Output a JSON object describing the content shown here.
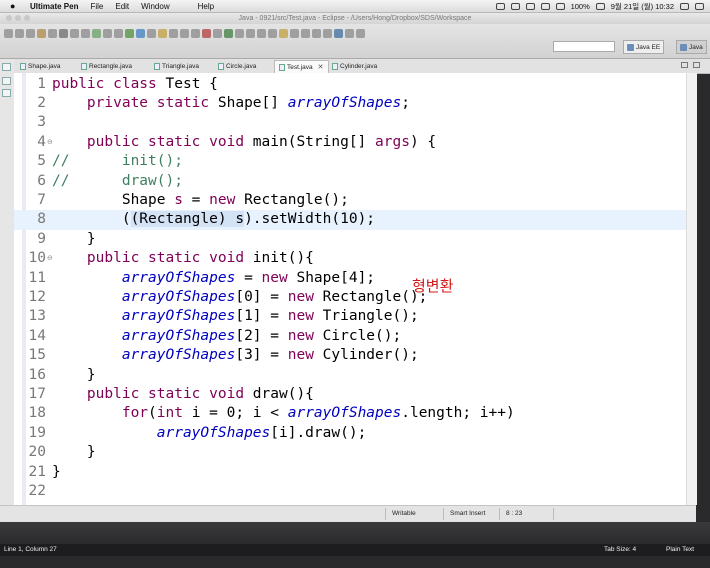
{
  "menubar": {
    "app_name": "Ultimate Pen",
    "items": [
      "File",
      "Edit",
      "Window",
      "Help"
    ],
    "status": {
      "battery": "100%",
      "date_time": "9월 21일 (월)  10:32"
    }
  },
  "window": {
    "title": "Java - 0921/src/Test.java - Eclipse - /Users/Hong/Dropbox/SDS/Workspace"
  },
  "perspectives": [
    "Java EE",
    "Java"
  ],
  "tabs": [
    {
      "label": "Shape.java"
    },
    {
      "label": "Rectangle.java"
    },
    {
      "label": "Triangle.java"
    },
    {
      "label": "Circle.java"
    },
    {
      "label": "Test.java",
      "active": true
    },
    {
      "label": "Cylinder.java"
    }
  ],
  "code_lines": [
    {
      "n": "1",
      "fold": ""
    },
    {
      "n": "2",
      "fold": ""
    },
    {
      "n": "3",
      "fold": ""
    },
    {
      "n": "4",
      "fold": "⊖"
    },
    {
      "n": "5",
      "fold": ""
    },
    {
      "n": "6",
      "fold": ""
    },
    {
      "n": "7",
      "fold": ""
    },
    {
      "n": "8",
      "fold": ""
    },
    {
      "n": "9",
      "fold": ""
    },
    {
      "n": "10",
      "fold": "⊖"
    },
    {
      "n": "11",
      "fold": ""
    },
    {
      "n": "12",
      "fold": ""
    },
    {
      "n": "13",
      "fold": ""
    },
    {
      "n": "14",
      "fold": ""
    },
    {
      "n": "15",
      "fold": ""
    },
    {
      "n": "16",
      "fold": ""
    },
    {
      "n": "17",
      "fold": ""
    },
    {
      "n": "18",
      "fold": ""
    },
    {
      "n": "19",
      "fold": ""
    },
    {
      "n": "20",
      "fold": ""
    },
    {
      "n": "21",
      "fold": ""
    },
    {
      "n": "22",
      "fold": ""
    }
  ],
  "code_tokens": [
    [
      {
        "t": "public class ",
        "c": "kw"
      },
      {
        "t": "Test {",
        "c": ""
      }
    ],
    [
      {
        "t": "    ",
        "c": ""
      },
      {
        "t": "private static ",
        "c": "kw"
      },
      {
        "t": "Shape[] ",
        "c": ""
      },
      {
        "t": "arrayOfShapes",
        "c": "field"
      },
      {
        "t": ";",
        "c": ""
      }
    ],
    [],
    [
      {
        "t": "    ",
        "c": ""
      },
      {
        "t": "public static void ",
        "c": "kw"
      },
      {
        "t": "main(String[] ",
        "c": ""
      },
      {
        "t": "args",
        "c": "kw"
      },
      {
        "t": ") {",
        "c": ""
      }
    ],
    [
      {
        "t": "//      init();",
        "c": "cm"
      }
    ],
    [
      {
        "t": "//      draw();",
        "c": "cm"
      }
    ],
    [
      {
        "t": "        Shape ",
        "c": ""
      },
      {
        "t": "s",
        "c": "kw"
      },
      {
        "t": " = ",
        "c": ""
      },
      {
        "t": "new ",
        "c": "kw"
      },
      {
        "t": "Rectangle();",
        "c": ""
      }
    ],
    [
      {
        "t": "        (",
        "c": ""
      },
      {
        "t": "(Rectangle) s",
        "c": "sel"
      },
      {
        "t": ").setWidth(10);",
        "c": ""
      }
    ],
    [
      {
        "t": "    }",
        "c": ""
      }
    ],
    [
      {
        "t": "    ",
        "c": ""
      },
      {
        "t": "public static void ",
        "c": "kw"
      },
      {
        "t": "init(){",
        "c": ""
      }
    ],
    [
      {
        "t": "        ",
        "c": ""
      },
      {
        "t": "arrayOfShapes",
        "c": "field"
      },
      {
        "t": " = ",
        "c": ""
      },
      {
        "t": "new ",
        "c": "kw"
      },
      {
        "t": "Shape[4];",
        "c": ""
      }
    ],
    [
      {
        "t": "        ",
        "c": ""
      },
      {
        "t": "arrayOfShapes",
        "c": "field"
      },
      {
        "t": "[0] = ",
        "c": ""
      },
      {
        "t": "new ",
        "c": "kw"
      },
      {
        "t": "Rectangle();",
        "c": ""
      }
    ],
    [
      {
        "t": "        ",
        "c": ""
      },
      {
        "t": "arrayOfShapes",
        "c": "field"
      },
      {
        "t": "[1] = ",
        "c": ""
      },
      {
        "t": "new ",
        "c": "kw"
      },
      {
        "t": "Triangle();",
        "c": ""
      }
    ],
    [
      {
        "t": "        ",
        "c": ""
      },
      {
        "t": "arrayOfShapes",
        "c": "field"
      },
      {
        "t": "[2] = ",
        "c": ""
      },
      {
        "t": "new ",
        "c": "kw"
      },
      {
        "t": "Circle();",
        "c": ""
      }
    ],
    [
      {
        "t": "        ",
        "c": ""
      },
      {
        "t": "arrayOfShapes",
        "c": "field"
      },
      {
        "t": "[3] = ",
        "c": ""
      },
      {
        "t": "new ",
        "c": "kw"
      },
      {
        "t": "Cylinder();",
        "c": ""
      }
    ],
    [
      {
        "t": "    }",
        "c": ""
      }
    ],
    [
      {
        "t": "    ",
        "c": ""
      },
      {
        "t": "public static void ",
        "c": "kw"
      },
      {
        "t": "draw(){",
        "c": ""
      }
    ],
    [
      {
        "t": "        ",
        "c": ""
      },
      {
        "t": "for",
        "c": "kw"
      },
      {
        "t": "(",
        "c": ""
      },
      {
        "t": "int ",
        "c": "kw"
      },
      {
        "t": "i = 0; i < ",
        "c": ""
      },
      {
        "t": "arrayOfShapes",
        "c": "field"
      },
      {
        "t": ".length; i++)",
        "c": ""
      }
    ],
    [
      {
        "t": "            ",
        "c": ""
      },
      {
        "t": "arrayOfShapes",
        "c": "field"
      },
      {
        "t": "[i].draw();",
        "c": ""
      }
    ],
    [
      {
        "t": "    }",
        "c": ""
      }
    ],
    [
      {
        "t": "}",
        "c": ""
      }
    ],
    []
  ],
  "current_line_index": 7,
  "annotation": "형변환",
  "status": {
    "mode": "Writable",
    "insert": "Smart Insert",
    "position": "8 : 23"
  },
  "bottom": {
    "left": "Line 1, Column 27",
    "tab_size": "Tab Size: 4",
    "syntax": "Plain Text"
  },
  "colors": {
    "keyword": "#7f0055",
    "field": "#0000c0",
    "comment": "#3f7f5f",
    "current_line": "#e8f2fe",
    "annotation": "#d21a1a"
  }
}
